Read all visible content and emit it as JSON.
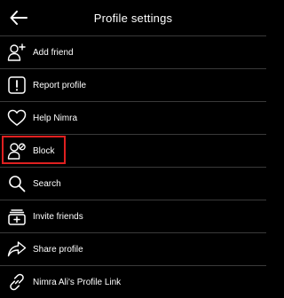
{
  "header": {
    "title": "Profile settings",
    "back_icon": "arrow-left-icon"
  },
  "menu": {
    "items": [
      {
        "label": "Add friend",
        "icon": "add-user-icon"
      },
      {
        "label": "Report profile",
        "icon": "alert-box-icon"
      },
      {
        "label": "Help Nimra",
        "icon": "heart-icon"
      },
      {
        "label": "Block",
        "icon": "block-user-icon",
        "highlighted": true
      },
      {
        "label": "Search",
        "icon": "search-icon"
      },
      {
        "label": "Invite friends",
        "icon": "invite-icon"
      },
      {
        "label": "Share profile",
        "icon": "share-icon"
      },
      {
        "label": "Nimra Ali's Profile Link",
        "icon": "link-icon"
      }
    ]
  },
  "colors": {
    "background": "#000000",
    "text": "#ffffff",
    "divider": "#3a3a3a",
    "highlight": "#e02020"
  }
}
